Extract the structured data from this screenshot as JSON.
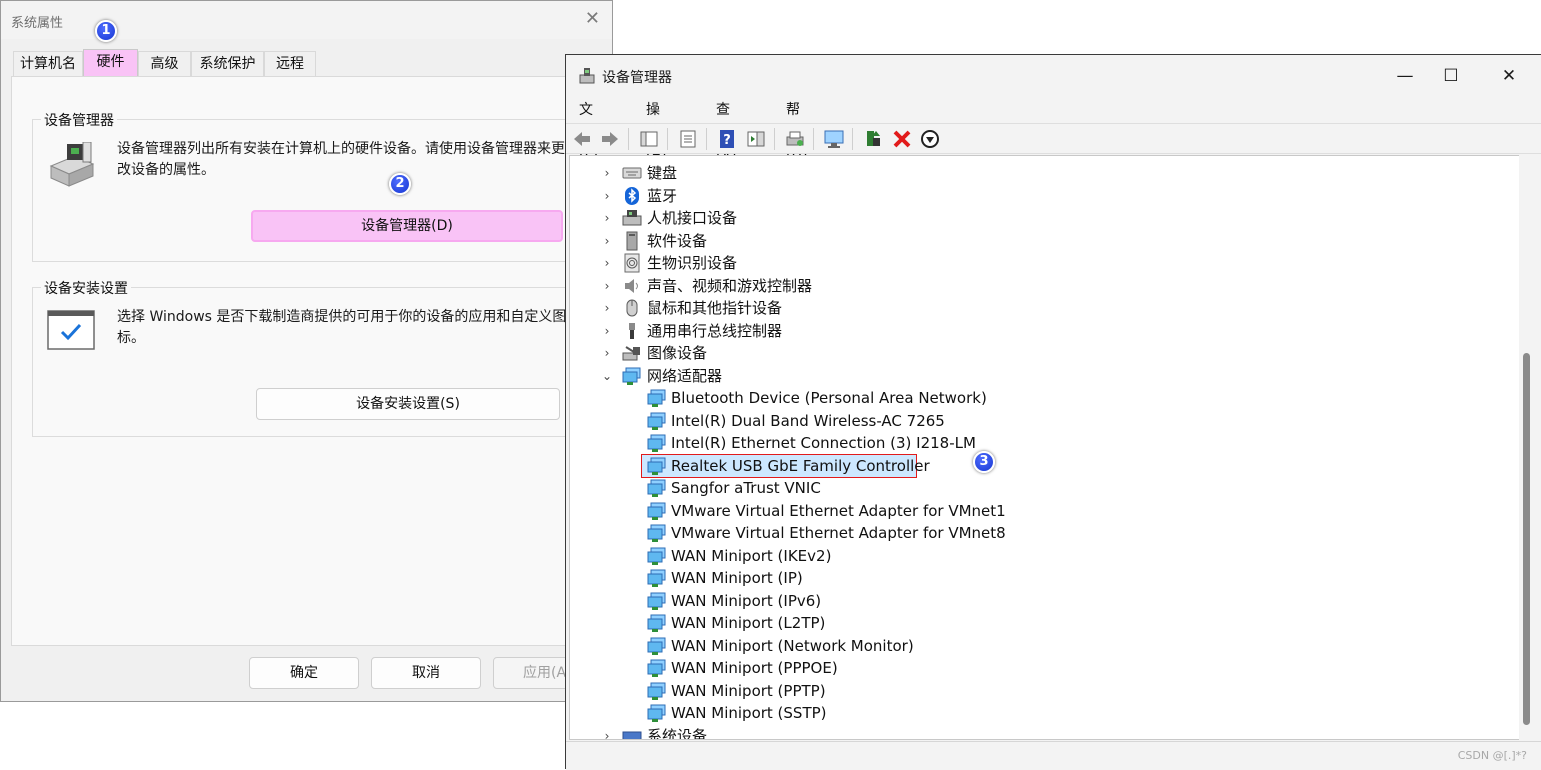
{
  "sysprop": {
    "title": "系统属性",
    "tabs": [
      {
        "label": "计算机名"
      },
      {
        "label": "硬件"
      },
      {
        "label": "高级"
      },
      {
        "label": "系统保护"
      },
      {
        "label": "远程"
      }
    ],
    "active_tab": "硬件",
    "device_manager_group": {
      "title": "设备管理器",
      "description": "设备管理器列出所有安装在计算机上的硬件设备。请使用设备管理器来更改设备的属性。",
      "button": "设备管理器(D)"
    },
    "install_group": {
      "title": "设备安装设置",
      "description": "选择 Windows 是否下载制造商提供的可用于你的设备的应用和自定义图标。",
      "button": "设备安装设置(S)"
    },
    "footer": {
      "ok": "确定",
      "cancel": "取消",
      "apply": "应用(A"
    }
  },
  "markers": {
    "m1": "1",
    "m2": "2",
    "m3": "3"
  },
  "devmgr": {
    "title": "设备管理器",
    "menu": {
      "file": "文件(F)",
      "action": "操作(A)",
      "view": "查看(V)",
      "help": "帮助(H)"
    },
    "tree": [
      {
        "label": "键盘",
        "icon": "keyboard-icon"
      },
      {
        "label": "蓝牙",
        "icon": "bluetooth-icon"
      },
      {
        "label": "人机接口设备",
        "icon": "hid-icon"
      },
      {
        "label": "软件设备",
        "icon": "software-device-icon"
      },
      {
        "label": "生物识别设备",
        "icon": "fingerprint-icon"
      },
      {
        "label": "声音、视频和游戏控制器",
        "icon": "speaker-icon"
      },
      {
        "label": "鼠标和其他指针设备",
        "icon": "mouse-icon"
      },
      {
        "label": "通用串行总线控制器",
        "icon": "usb-icon"
      },
      {
        "label": "图像设备",
        "icon": "camera-icon"
      },
      {
        "label": "网络适配器",
        "icon": "network-adapter-icon",
        "expanded": true
      }
    ],
    "network_adapters": [
      "Bluetooth Device (Personal Area Network)",
      "Intel(R) Dual Band Wireless-AC 7265",
      "Intel(R) Ethernet Connection (3) I218-LM",
      "Realtek USB GbE Family Controller",
      "Sangfor aTrust VNIC",
      "VMware Virtual Ethernet Adapter for VMnet1",
      "VMware Virtual Ethernet Adapter for VMnet8",
      "WAN Miniport (IKEv2)",
      "WAN Miniport (IP)",
      "WAN Miniport (IPv6)",
      "WAN Miniport (L2TP)",
      "WAN Miniport (Network Monitor)",
      "WAN Miniport (PPPOE)",
      "WAN Miniport (PPTP)",
      "WAN Miniport (SSTP)"
    ],
    "selected_adapter": "Realtek USB GbE Family Controller",
    "partial_row": {
      "label": "系统设备",
      "icon": "system-device-icon"
    },
    "watermark": "CSDN @[.]*?"
  },
  "colors": {
    "highlight_pink": "#f9c3f6",
    "selection_red": "#e21b1b",
    "selection_fill": "#cde8ff",
    "marker_blue": "#1a3fdc"
  }
}
